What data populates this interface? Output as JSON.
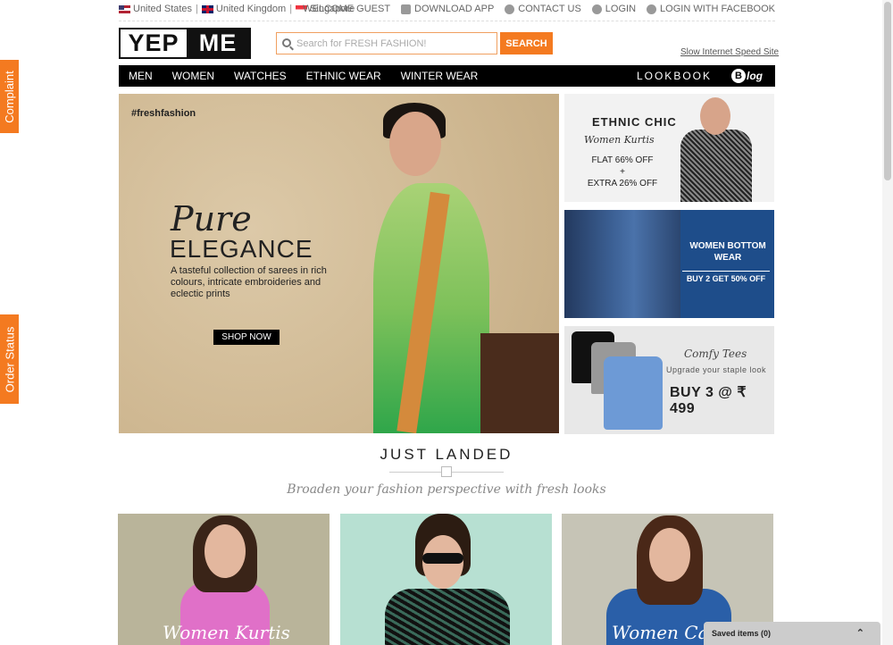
{
  "side_tabs": {
    "complaint": "Complaint",
    "order_status": "Order Status"
  },
  "topbar": {
    "countries": [
      "United States",
      "United Kingdom",
      "Singapore"
    ],
    "links": {
      "welcome": "WELCOME GUEST",
      "download": "DOWNLOAD APP",
      "contact": "CONTACT US",
      "login": "LOGIN",
      "facebook": "LOGIN WITH FACEBOOK"
    }
  },
  "header": {
    "logo_left": "YEP",
    "logo_right": "ME",
    "search_placeholder": "Search for FRESH FASHION!",
    "search_button": "SEARCH",
    "slow_link": "Slow Internet Speed Site"
  },
  "nav": {
    "items": [
      "MEN",
      "WOMEN",
      "WATCHES",
      "ETHNIC WEAR",
      "WINTER WEAR"
    ],
    "lookbook": "LOOKBOOK",
    "blog_letter": "B",
    "blog": "log"
  },
  "hero": {
    "tag": "#freshfashion",
    "script": "Pure",
    "title": "ELEGANCE",
    "desc": "A tasteful collection of sarees in rich colours, intricate embroideries and eclectic prints",
    "cta": "SHOP NOW"
  },
  "banners": {
    "ethnic": {
      "title": "ETHNIC CHIC",
      "sub": "Women Kurtis",
      "offer1": "FLAT 66% OFF",
      "plus": "+",
      "offer2": "EXTRA 26% OFF"
    },
    "bottom": {
      "title": "WOMEN BOTTOM WEAR",
      "offer": "BUY 2 GET 50% OFF"
    },
    "tees": {
      "script": "Comfy Tees",
      "sub": "Upgrade your staple look",
      "offer": "BUY 3 @ ₹ 499"
    }
  },
  "just_landed": {
    "title": "JUST LANDED",
    "subtitle": "Broaden your fashion perspective with fresh looks",
    "products": [
      {
        "label": "Women Kurtis"
      },
      {
        "label": ""
      },
      {
        "label": "Women Ca"
      }
    ]
  },
  "saved": {
    "label": "Saved items (0)",
    "chevron": "⌃"
  }
}
